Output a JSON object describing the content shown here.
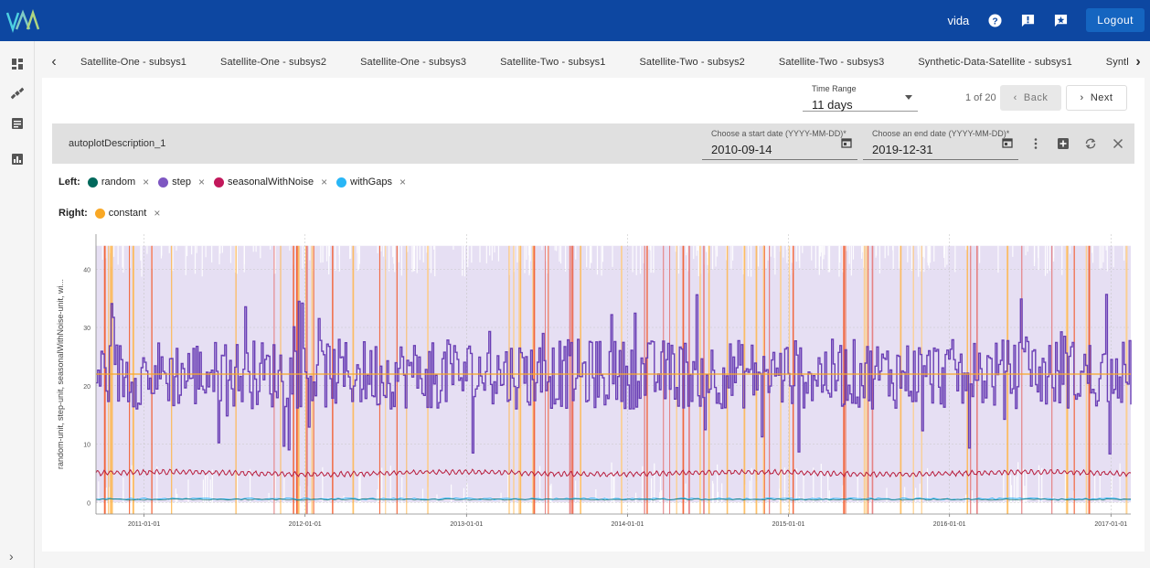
{
  "app": {
    "name": "VAM",
    "brand_color": "#0d47a1"
  },
  "topbar": {
    "username": "vida",
    "icons": [
      "help-icon",
      "feedback-icon",
      "announcement-icon"
    ],
    "logout_label": "Logout"
  },
  "sidebar": {
    "items": [
      "dashboard-icon",
      "satellite-icon",
      "document-icon",
      "chart-icon"
    ],
    "expand_icon": "chevron-right-icon"
  },
  "tabs": [
    "Satellite-One - subsys1",
    "Satellite-One - subsys2",
    "Satellite-One - subsys3",
    "Satellite-Two - subsys1",
    "Satellite-Two - subsys2",
    "Satellite-Two - subsys3",
    "Synthetic-Data-Satellite - subsys1",
    "Synthetic-Data-"
  ],
  "toolbar": {
    "time_range_label": "Time Range",
    "time_range_value": "11 days",
    "pager": "1 of 20",
    "back_label": "Back",
    "next_label": "Next"
  },
  "card": {
    "title": "autoplotDescription_1",
    "start_label": "Choose a start date (YYYY-MM-DD)*",
    "start_value": "2010-09-14",
    "end_label": "Choose an end date (YYYY-MM-DD)*",
    "end_value": "2019-12-31"
  },
  "legend": {
    "left_label": "Left:",
    "right_label": "Right:",
    "left": [
      {
        "name": "random",
        "color": "#00695c"
      },
      {
        "name": "step",
        "color": "#7e57c2"
      },
      {
        "name": "seasonalWithNoise",
        "color": "#c2185b"
      },
      {
        "name": "withGaps",
        "color": "#29b6f6"
      }
    ],
    "right": [
      {
        "name": "constant",
        "color": "#f9a825"
      }
    ],
    "remove_glyph": "×"
  },
  "chart_data": {
    "type": "line",
    "ylabel": "random-unit, step-unit, seasonalWithNoise-unit, wi...",
    "xlabel": "",
    "x_ticks": [
      "2011-01-01",
      "2012-01-01",
      "2013-01-01",
      "2014-01-01",
      "2015-01-01",
      "2016-01-01",
      "2017-01-01"
    ],
    "y_ticks": [
      "0",
      "10",
      "20",
      "30",
      "40"
    ],
    "ylim": [
      -2,
      46
    ],
    "xlim": [
      "2010-09-14",
      "2017-02-15"
    ],
    "grid": true,
    "series": [
      {
        "name": "random",
        "approx_mean": 0.5,
        "approx_range": [
          0.3,
          0.9
        ]
      },
      {
        "name": "step",
        "approx_mean": 22,
        "approx_range": [
          8,
          36
        ]
      },
      {
        "name": "seasonalWithNoise",
        "approx_mean": 5,
        "approx_range": [
          4.2,
          5.8
        ]
      },
      {
        "name": "withGaps",
        "approx_mean": 0.6,
        "approx_range": [
          0.4,
          0.8
        ]
      },
      {
        "name": "constant",
        "value": 22
      }
    ],
    "band": {
      "lower": 0,
      "upper": 44,
      "color": "#d1c4e9"
    }
  }
}
